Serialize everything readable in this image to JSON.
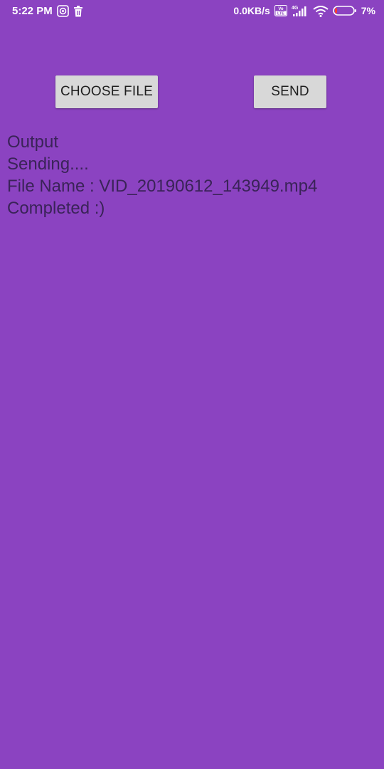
{
  "status_bar": {
    "time": "5:22 PM",
    "left_icons": [
      "app-notification-icon",
      "trash-icon"
    ],
    "net_speed": "0.0KB/s",
    "volte_label": "Vo LTE",
    "network_label": "4G",
    "battery_percent": "7%",
    "battery_level": 0.07,
    "battery_color": "#ff3b30"
  },
  "buttons": {
    "choose_file": "CHOOSE FILE",
    "send": "SEND"
  },
  "output": {
    "heading": "Output",
    "line_sending": "Sending....",
    "line_file_name": "File Name : VID_20190612_143949.mp4",
    "line_completed": "Completed :)"
  },
  "colors": {
    "background": "#8b43c1",
    "text": "#3a2358",
    "button_bg": "#d8d8d8"
  }
}
